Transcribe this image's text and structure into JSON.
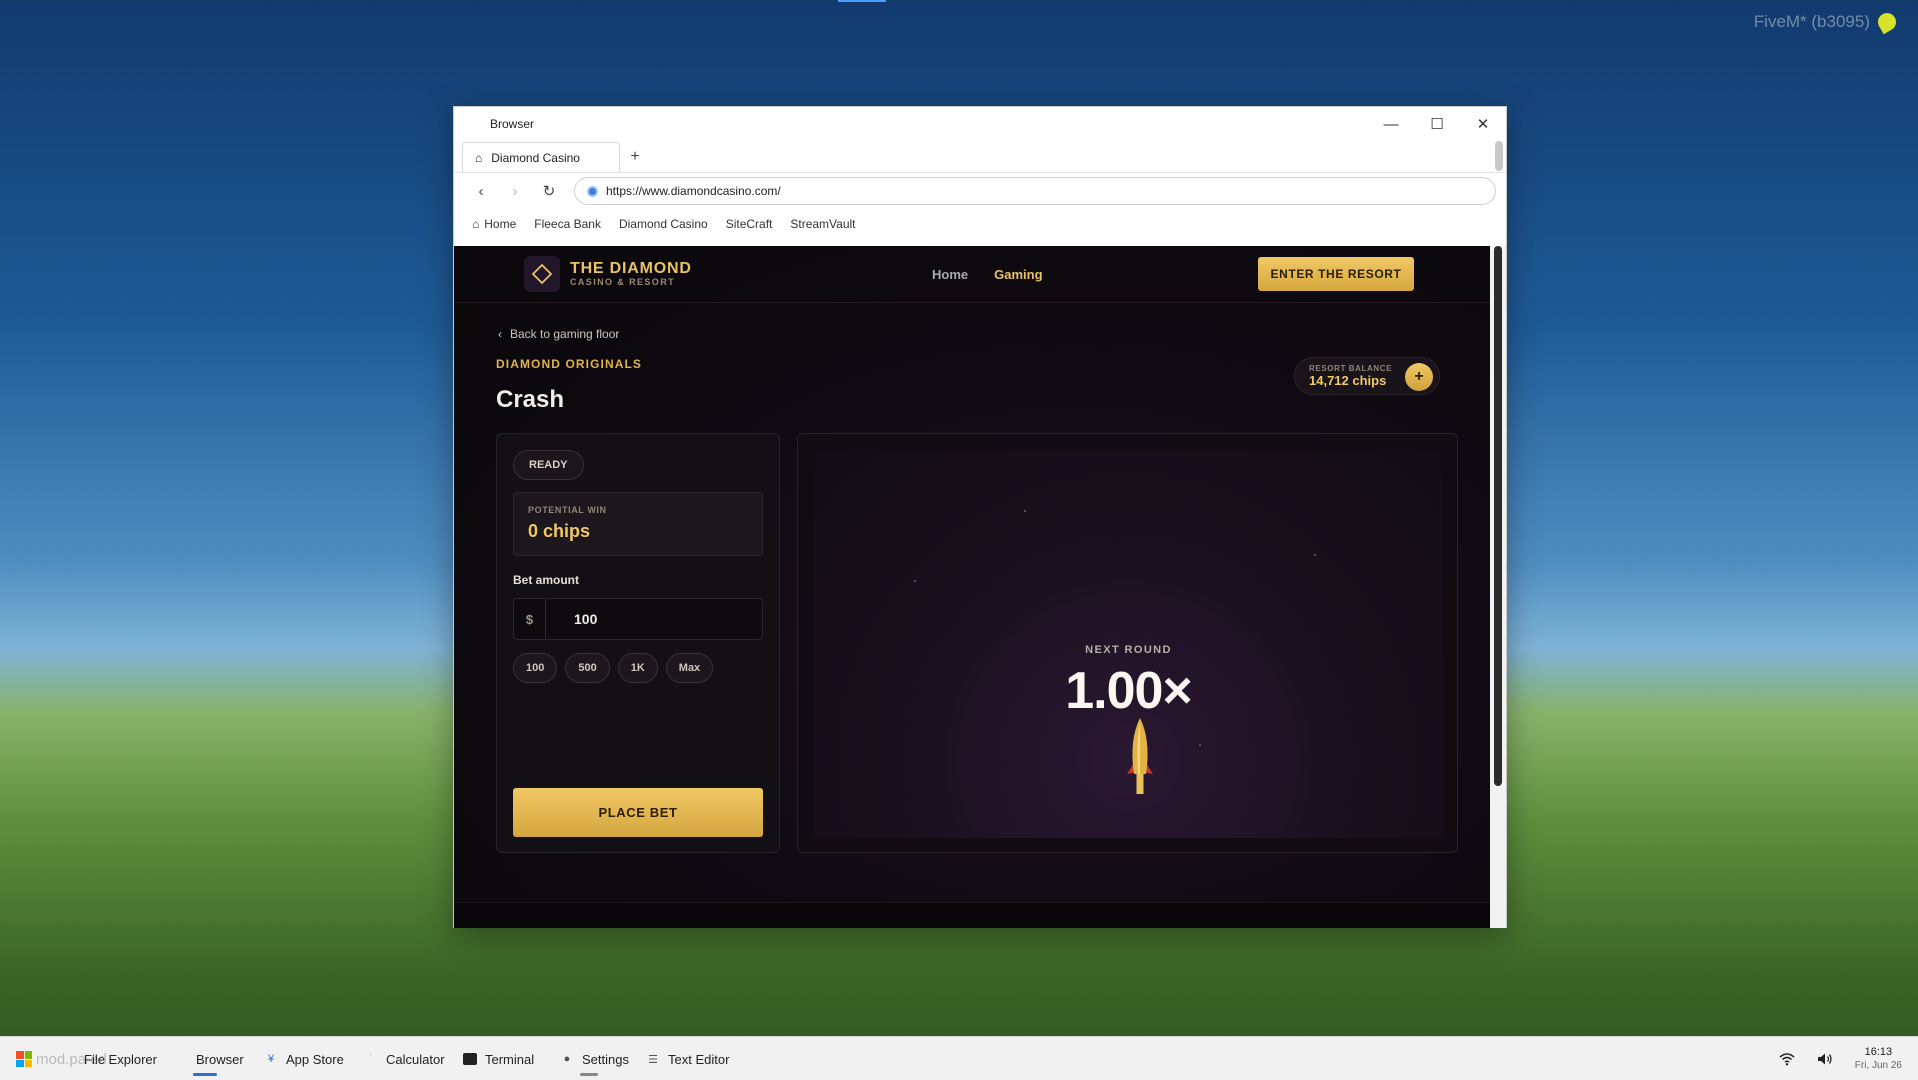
{
  "desktop": {
    "overlay_text": "FiveM* (b3095)",
    "ghost_text": "mod.pa  ed"
  },
  "browser": {
    "window_title": "Browser",
    "tab_title": "Diamond Casino",
    "new_tab": "+",
    "url": "https://www.diamondcasino.com/",
    "bookmarks": [
      "Home",
      "Fleeca Bank",
      "Diamond Casino",
      "SiteCraft",
      "StreamVault"
    ]
  },
  "site": {
    "logo_title": "THE DIAMOND",
    "logo_subtitle": "CASINO & RESORT",
    "nav": {
      "home": "Home",
      "gaming": "Gaming"
    },
    "cta": "ENTER THE RESORT",
    "back_link": "Back to gaming floor",
    "section": "DIAMOND ORIGINALS",
    "game_title": "Crash",
    "balance": {
      "label": "RESORT BALANCE",
      "value": "14,712 chips",
      "add": "+"
    },
    "panel": {
      "status": "READY",
      "potential_label": "POTENTIAL WIN",
      "potential_value": "0 chips",
      "bet_label": "Bet amount",
      "currency": "$",
      "bet_value": "100",
      "quick_bets": [
        "100",
        "500",
        "1K",
        "Max"
      ],
      "place_bet": "PLACE BET"
    },
    "game": {
      "round_label": "NEXT ROUND",
      "multiplier": "1.00×"
    },
    "accent_color": "#e9c266"
  },
  "taskbar": {
    "items": [
      "File Explorer",
      "Browser",
      "App Store",
      "Calculator",
      "Terminal",
      "Settings",
      "Text Editor"
    ],
    "time": "16:13",
    "date": "Fri, Jun 26"
  }
}
